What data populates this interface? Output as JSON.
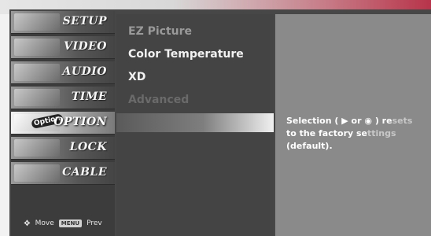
{
  "menu": {
    "items": [
      {
        "label": "SETUP"
      },
      {
        "label": "VIDEO"
      },
      {
        "label": "AUDIO"
      },
      {
        "label": "TIME"
      },
      {
        "label": "OPTION",
        "tag": "Option"
      },
      {
        "label": "LOCK"
      },
      {
        "label": "CABLE"
      }
    ],
    "active_index": 4,
    "footer": {
      "move_label": "Move",
      "prev_key": "MENU",
      "prev_label": "Prev"
    }
  },
  "submenu": {
    "items": [
      {
        "label": "EZ Picture",
        "state": "dim"
      },
      {
        "label": "Color Temperature",
        "state": "normal"
      },
      {
        "label": "XD",
        "state": "normal"
      },
      {
        "label": "Advanced",
        "state": "muted"
      }
    ],
    "selected_label": ""
  },
  "info": {
    "line1_a": "Selection ( ",
    "line1_arrow": "▶",
    "line1_b": " or ",
    "line1_ok": "◉",
    "line1_c": " ) re",
    "line1_fade": "sets",
    "line2_a": "to the factory se",
    "line2_fade": "ttings",
    "line3": "(default)."
  },
  "colors": {
    "panel_dark": "#444444",
    "panel_info": "#8a8a8a",
    "highlight": "#f0f0f0"
  },
  "icons": {
    "move": "four-way-arrow-icon"
  }
}
